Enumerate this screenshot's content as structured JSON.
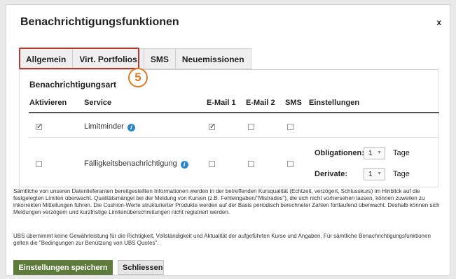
{
  "dialog": {
    "title": "Benachrichtigungsfunktionen",
    "close_label": "x"
  },
  "tabs": [
    {
      "label": "Allgemein",
      "active": true
    },
    {
      "label": "Virt. Portfolios",
      "active": false
    },
    {
      "label": "SMS",
      "active": false
    },
    {
      "label": "Neuemissionen",
      "active": false
    }
  ],
  "annotation_badge": "5",
  "section": {
    "title": "Benachrichtigungsart",
    "columns": {
      "activate": "Aktivieren",
      "service": "Service",
      "email1": "E-Mail 1",
      "email2": "E-Mail 2",
      "sms": "SMS",
      "settings": "Einstellungen"
    },
    "rows": [
      {
        "service": "Limitminder",
        "activate": true,
        "email1": true,
        "email2": false,
        "sms": false
      },
      {
        "service": "Fälligkeitsbenachrichtigung",
        "activate": false,
        "email1": false,
        "email2": false,
        "sms": false
      }
    ],
    "settings": {
      "obligationen_label": "Obligationen:",
      "obligationen_value": "1",
      "derivate_label": "Derivate:",
      "derivate_value": "1",
      "unit": "Tage"
    }
  },
  "disclaimer": {
    "p1": "Sämtliche von unseren Datenlieferanten bereitgestellten Informationen werden in der betreffenden Kursqualität (Echtzeit, verzögert, Schlusskurs) im Hinblick auf die festgelegten Limiten überwacht. Qualitätsmängel bei der Meldung von Kursen (z.B. Fehleingaben/\"Mistrades\"), die sich nicht vorhersehen lassen, können zuweilen zu inkorrekten Mitteilungen führen. Die Cushion-Werte strukturierter Produkte werden auf der Basis periodisch berechneter Zahlen fortlaufend überwacht. Deshalb können sich Meldungen verzögern und kurzfristige Limitenüberschreitungen nicht registriert werden.",
    "p2": "UBS übernimmt keine Gewährleistung für die Richtigkeit, Vollständigkeit und Aktualität der aufgeführten Kurse und Angaben. Für sämtliche Benachrichtigungsfunktionen gelten die \"Bedingungen zur Benützung von UBS Quotes\"."
  },
  "buttons": {
    "save": "Einstellungen speichern",
    "close": "Schliessen"
  },
  "colors": {
    "save_button": "#5e7b3c",
    "highlight_border": "#b03a2e",
    "badge": "#e07a24",
    "info_icon": "#2e86c9"
  }
}
